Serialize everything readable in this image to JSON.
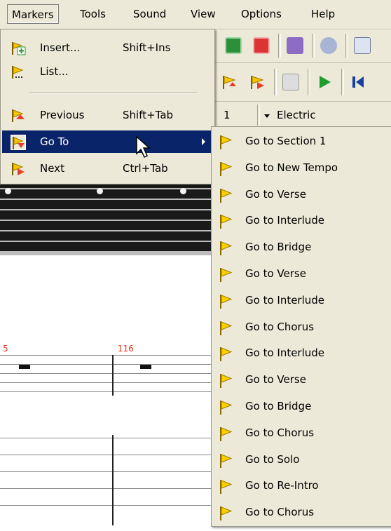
{
  "menubar": {
    "items": [
      "Markers",
      "Tools",
      "Sound",
      "View",
      "Options",
      "Help"
    ]
  },
  "markers_menu": {
    "items": [
      {
        "label": "Insert...",
        "shortcut": "Shift+Ins",
        "icon": "insert-marker-icon"
      },
      {
        "label": "List...",
        "shortcut": "",
        "icon": "marker-list-icon"
      },
      {
        "label": "Previous",
        "shortcut": "Shift+Tab",
        "icon": "previous-marker-icon"
      },
      {
        "label": "Go To",
        "shortcut": "",
        "icon": "goto-marker-icon"
      },
      {
        "label": "Next",
        "shortcut": "Ctrl+Tab",
        "icon": "next-marker-icon"
      }
    ]
  },
  "goto_submenu": {
    "items": [
      "Go to Section 1",
      "Go to New Tempo",
      "Go to Verse",
      "Go to Interlude",
      "Go to Bridge",
      "Go to Verse",
      "Go to Interlude",
      "Go to Chorus",
      "Go to Interlude",
      "Go to Verse",
      "Go to Bridge",
      "Go to Chorus",
      "Go to Solo",
      "Go to Re-Intro",
      "Go to Chorus"
    ]
  },
  "background": {
    "track_number": "1",
    "instrument": "Electric",
    "measure_numbers": [
      "5",
      "116"
    ]
  },
  "colors": {
    "menu_bg": "#ece9d8",
    "highlight": "#0a246a",
    "marker_flag": "#f5c400",
    "measure_number": "#e8311c"
  }
}
